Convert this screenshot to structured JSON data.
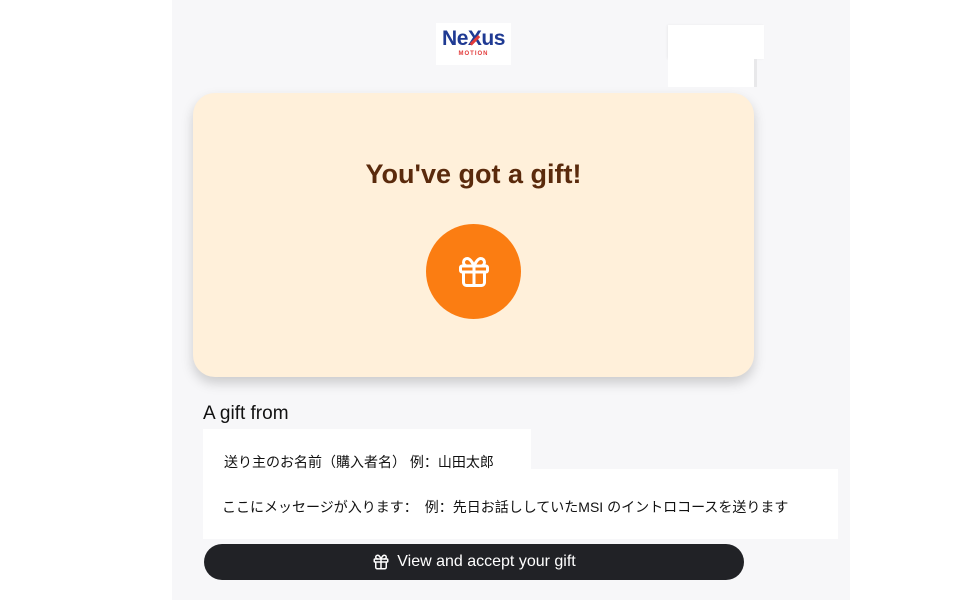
{
  "logo": {
    "main": "NeXus",
    "sub": "MOTION"
  },
  "gift_card": {
    "title": "You've got a gift!",
    "icon": "gift-icon"
  },
  "sender": {
    "label": "A gift from",
    "name": "送り主のお名前（購入者名） 例：山田太郎",
    "message": "ここにメッセージが入ります：　例：先日お話ししていたMSI のイントロコースを送ります"
  },
  "accept_button": {
    "label": "View and accept your gift",
    "icon": "gift-icon"
  },
  "colors": {
    "card_bg": "#fff0da",
    "title": "#5a2a0c",
    "accent": "#fb7d12",
    "button_bg": "#212226",
    "page_bg": "#f7f7f9"
  }
}
